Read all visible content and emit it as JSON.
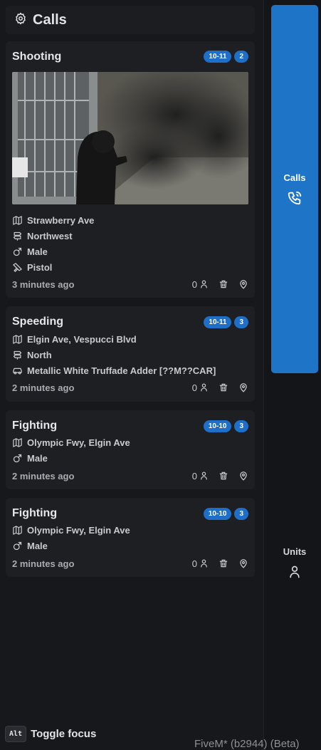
{
  "header": {
    "title": "Calls",
    "icon": "gear-icon"
  },
  "calls": [
    {
      "title": "Shooting",
      "code": "10-11",
      "units": "2",
      "details": [
        {
          "icon": "map-icon",
          "text": "Strawberry Ave"
        },
        {
          "icon": "signpost-icon",
          "text": "Northwest"
        },
        {
          "icon": "male-icon",
          "text": "Male"
        },
        {
          "icon": "pistol-icon",
          "text": "Pistol"
        }
      ],
      "time": "3 minutes ago",
      "attached": "0"
    },
    {
      "title": "Speeding",
      "code": "10-11",
      "units": "3",
      "details": [
        {
          "icon": "map-icon",
          "text": "Elgin Ave, Vespucci Blvd"
        },
        {
          "icon": "signpost-icon",
          "text": "North"
        },
        {
          "icon": "car-icon",
          "text": "Metallic White Truffade Adder [??M??CAR]"
        }
      ],
      "time": "2 minutes ago",
      "attached": "0"
    },
    {
      "title": "Fighting",
      "code": "10-10",
      "units": "3",
      "details": [
        {
          "icon": "map-icon",
          "text": "Olympic Fwy, Elgin Ave"
        },
        {
          "icon": "male-icon",
          "text": "Male"
        }
      ],
      "time": "2 minutes ago",
      "attached": "0"
    },
    {
      "title": "Fighting",
      "code": "10-10",
      "units": "3",
      "details": [
        {
          "icon": "map-icon",
          "text": "Olympic Fwy, Elgin Ave"
        },
        {
          "icon": "male-icon",
          "text": "Male"
        }
      ],
      "time": "2 minutes ago",
      "attached": "0"
    }
  ],
  "tabs": {
    "calls": {
      "label": "Calls",
      "icon": "phone-call-icon"
    },
    "units": {
      "label": "Units",
      "icon": "user-icon"
    }
  },
  "hint": {
    "key": "Alt",
    "label": "Toggle focus"
  },
  "watermark": "FiveM* (b2944) (Beta)",
  "colors": {
    "accent": "#1e74c7",
    "badge": "#1f6fc9",
    "card": "#1e1f23",
    "background": "#17181b"
  }
}
